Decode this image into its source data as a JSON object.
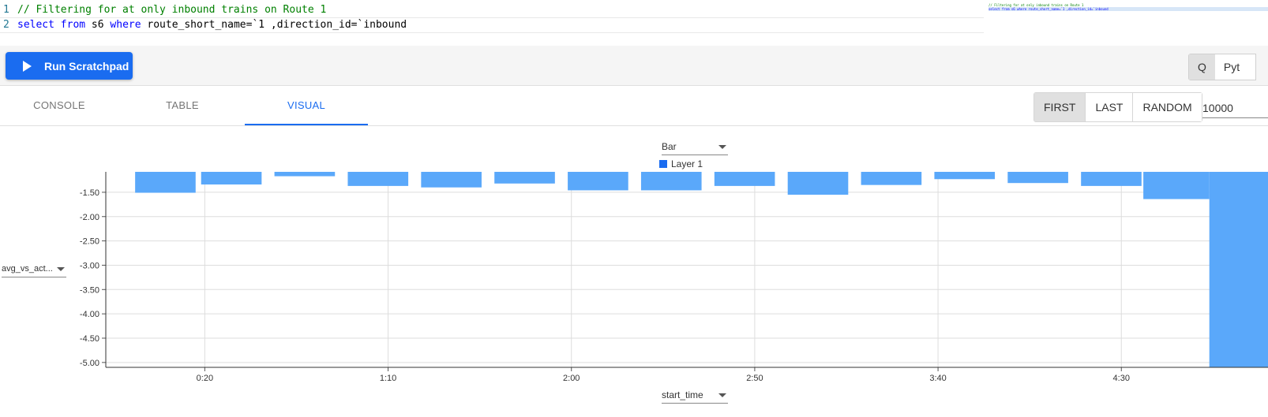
{
  "editor": {
    "lines": [
      {
        "number": "1",
        "comment": "// Filtering for at only inbound trains on Route 1"
      },
      {
        "number": "2",
        "parts": {
          "kw1": "select",
          "t1": " ",
          "kw2": "from",
          "t2": " s6 ",
          "kw3": "where",
          "t3": " route_short_name=`1 ,direction_id=`inbound"
        }
      }
    ],
    "minimap": {
      "line1": "// Filtering for at only inbound trains on Route 1",
      "line2": "select from s6 where route_short_name=`1 ,direction_id=`inbound"
    }
  },
  "toolbar": {
    "run_label": "Run Scratchpad",
    "lang_q": "Q",
    "lang_py": "Pyt"
  },
  "tabs": [
    "CONSOLE",
    "TABLE",
    "VISUAL"
  ],
  "active_tab": "VISUAL",
  "sampling": {
    "options": [
      "FIRST",
      "LAST",
      "RANDOM"
    ],
    "active": "FIRST",
    "limit": "10000"
  },
  "chart_controls": {
    "chart_type": "Bar",
    "y_field": "avg_vs_act...",
    "x_field": "start_time",
    "legend_label": "Layer 1"
  },
  "colors": {
    "accent": "#1a6cf0",
    "bar": "#5aa8fa"
  },
  "chart_data": {
    "type": "bar",
    "title": "",
    "xlabel": "start_time",
    "ylabel": "avg_vs_act...",
    "x_ticks": [
      "0:20",
      "1:10",
      "2:00",
      "2:50",
      "3:40",
      "4:30"
    ],
    "x_tick_minutes": [
      20,
      70,
      120,
      170,
      220,
      270
    ],
    "xlim_minutes": [
      -7,
      310
    ],
    "y_ticks": [
      "-1.50",
      "-2.00",
      "-2.50",
      "-3.00",
      "-3.50",
      "-4.00",
      "-4.50",
      "-5.00"
    ],
    "ylim": [
      -5.1,
      -1.08
    ],
    "baseline": -1.08,
    "grid": true,
    "series": [
      {
        "name": "Layer 1",
        "bars": [
          {
            "start_min": 1,
            "end_min": 17.5,
            "value": -1.51
          },
          {
            "start_min": 19,
            "end_min": 35.5,
            "value": -1.34
          },
          {
            "start_min": 39,
            "end_min": 55.5,
            "value": -1.17
          },
          {
            "start_min": 59,
            "end_min": 75.5,
            "value": -1.37
          },
          {
            "start_min": 79,
            "end_min": 95.5,
            "value": -1.4
          },
          {
            "start_min": 99,
            "end_min": 115.5,
            "value": -1.32
          },
          {
            "start_min": 119,
            "end_min": 135.5,
            "value": -1.46
          },
          {
            "start_min": 139,
            "end_min": 155.5,
            "value": -1.46
          },
          {
            "start_min": 159,
            "end_min": 175.5,
            "value": -1.37
          },
          {
            "start_min": 179,
            "end_min": 195.5,
            "value": -1.55
          },
          {
            "start_min": 199,
            "end_min": 215.5,
            "value": -1.35
          },
          {
            "start_min": 219,
            "end_min": 235.5,
            "value": -1.23
          },
          {
            "start_min": 239,
            "end_min": 255.5,
            "value": -1.31
          },
          {
            "start_min": 259,
            "end_min": 275.5,
            "value": -1.37
          },
          {
            "start_min": 276,
            "end_min": 294,
            "value": -1.64
          },
          {
            "start_min": 294,
            "end_min": 310,
            "value": -5.1
          }
        ]
      }
    ]
  }
}
